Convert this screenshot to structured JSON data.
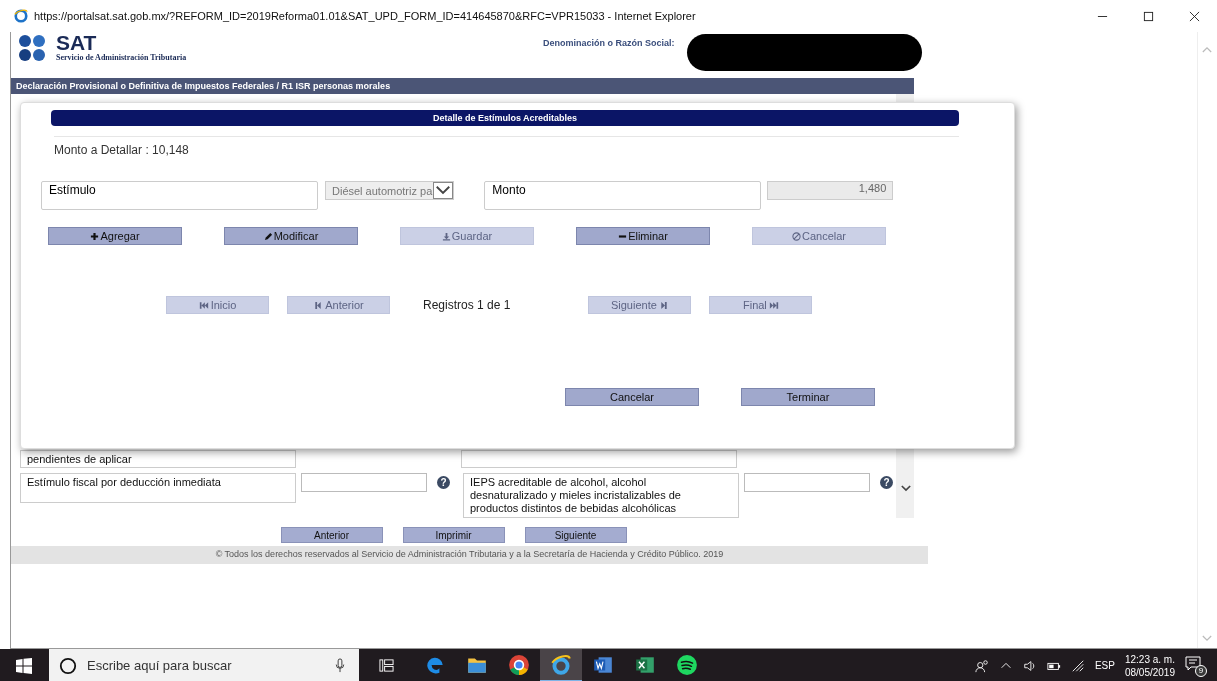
{
  "window": {
    "title": "https://portalsat.sat.gob.mx/?REFORM_ID=2019Reforma01.01&SAT_UPD_FORM_ID=414645870&RFC=VPR15033 - Internet Explorer"
  },
  "header": {
    "logo_text": "SAT",
    "logo_subtitle": "Servicio de Administración Tributaria",
    "name_label": "Denominación o Razón Social:"
  },
  "breadcrumb": "Declaración Provisional o Definitiva de Impuestos Federales / R1 ISR personas morales",
  "form": {
    "rows": [
      {
        "left_label": "pendientes de aplicar"
      },
      {
        "left_label": "Estímulo fiscal por deducción inmediata",
        "right_label": "IEPS acreditable de alcohol, alcohol desnaturalizado y mieles incristalizables de productos distintos de bebidas alcohólicas",
        "left_help": "?",
        "right_help": "?"
      }
    ]
  },
  "page_buttons": [
    "Anterior",
    "Imprimir",
    "Siguiente"
  ],
  "footer": "© Todos los derechos reservados al Servicio de Administración Tributaria y a la Secretaría de Hacienda y Crédito Público. 2019",
  "modal": {
    "title": "Detalle de Estímulos Acreditables",
    "amount_label": "Monto a Detallar : 10,148",
    "stimulus_label": "Estímulo",
    "stimulus_select": "Diésel automotriz pa",
    "amount_field_label": "Monto",
    "amount_value": "1,480",
    "actions": [
      {
        "label": "Agregar",
        "kind": "add",
        "disabled": false
      },
      {
        "label": "Modificar",
        "kind": "edit",
        "disabled": false
      },
      {
        "label": "Guardar",
        "kind": "save",
        "disabled": true
      },
      {
        "label": "Eliminar",
        "kind": "remove",
        "disabled": false
      },
      {
        "label": "Cancelar",
        "kind": "cancel",
        "disabled": true
      }
    ],
    "nav": [
      {
        "label": "Inicio",
        "kind": "first",
        "disabled": true
      },
      {
        "label": "Anterior",
        "kind": "prev",
        "disabled": true
      },
      {
        "label": "Siguiente",
        "kind": "next",
        "disabled": true
      },
      {
        "label": "Final",
        "kind": "last",
        "disabled": true
      }
    ],
    "records": "Registros 1 de 1",
    "buttons": [
      "Cancelar",
      "Terminar"
    ]
  },
  "taskbar": {
    "search_placeholder": "Escribe aquí para buscar",
    "apps": [
      {
        "kind": "edge",
        "selected": false
      },
      {
        "kind": "folder",
        "selected": false
      },
      {
        "kind": "chrome",
        "selected": false
      },
      {
        "kind": "ie",
        "selected": true
      },
      {
        "kind": "word",
        "selected": false
      },
      {
        "kind": "excel",
        "selected": false
      },
      {
        "kind": "spotify",
        "selected": false
      }
    ],
    "language": "ESP",
    "time": "12:23 a. m.",
    "date": "08/05/2019",
    "notification_count": "9"
  }
}
